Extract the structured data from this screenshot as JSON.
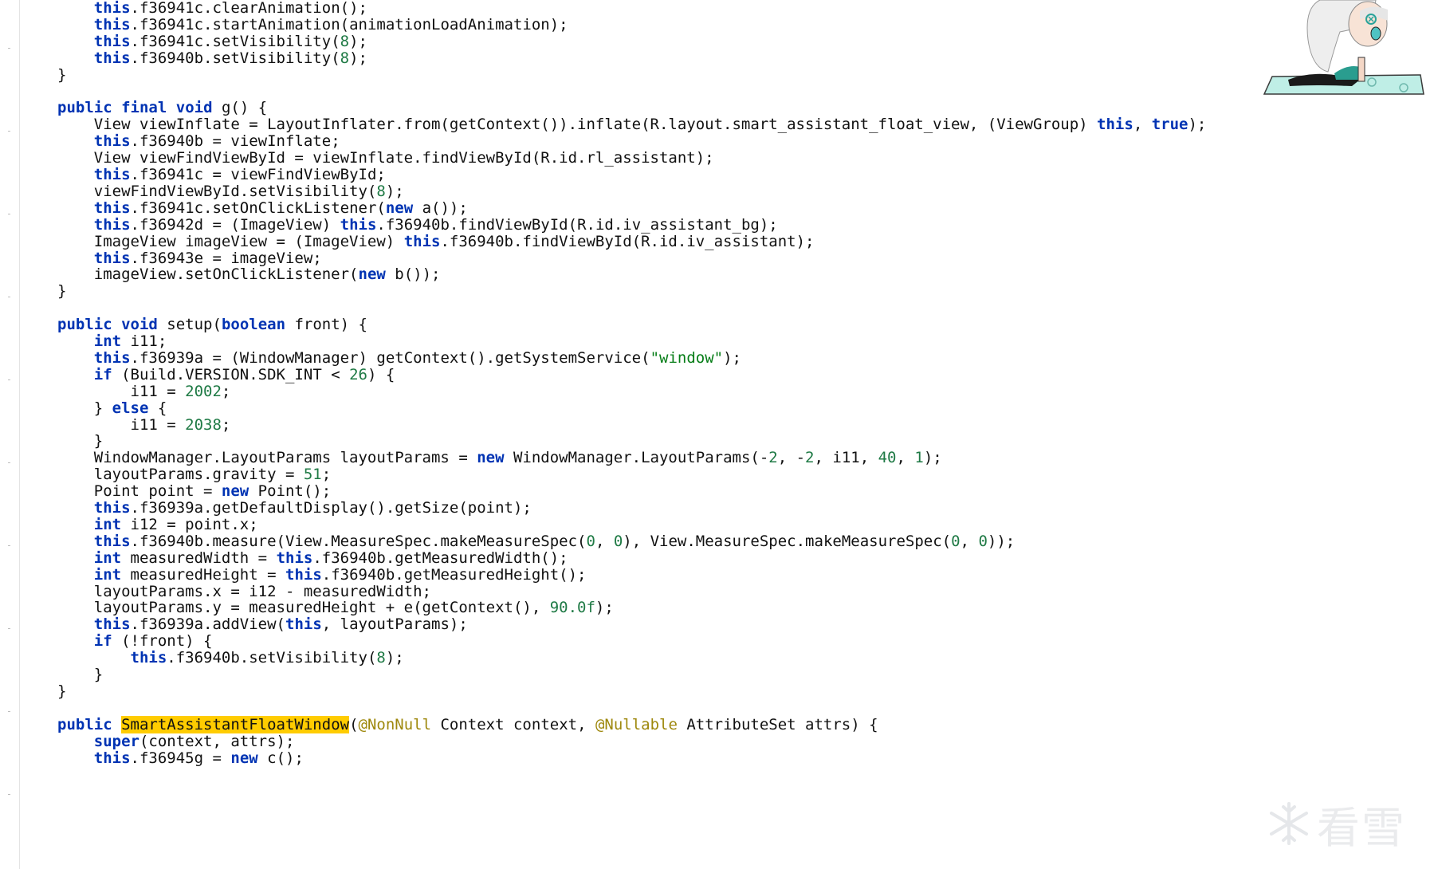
{
  "editor": {
    "lines": [
      [
        [
          "t",
          "    "
        ],
        [
          "kw",
          "this"
        ],
        [
          "t",
          ".f36941c.clearAnimation();"
        ]
      ],
      [
        [
          "t",
          "    "
        ],
        [
          "kw",
          "this"
        ],
        [
          "t",
          ".f36941c.startAnimation(animationLoadAnimation);"
        ]
      ],
      [
        [
          "t",
          "    "
        ],
        [
          "kw",
          "this"
        ],
        [
          "t",
          ".f36941c.setVisibility("
        ],
        [
          "num",
          "8"
        ],
        [
          "t",
          ");"
        ]
      ],
      [
        [
          "t",
          "    "
        ],
        [
          "kw",
          "this"
        ],
        [
          "t",
          ".f36940b.setVisibility("
        ],
        [
          "num",
          "8"
        ],
        [
          "t",
          ");"
        ]
      ],
      [
        [
          "t",
          "}"
        ]
      ],
      [
        [
          "t",
          ""
        ]
      ],
      [
        [
          "kw",
          "public"
        ],
        [
          "t",
          " "
        ],
        [
          "kw",
          "final"
        ],
        [
          "t",
          " "
        ],
        [
          "kw",
          "void"
        ],
        [
          "t",
          " g() {"
        ]
      ],
      [
        [
          "t",
          "    View viewInflate = LayoutInflater.from(getContext()).inflate(R.layout.smart_assistant_float_view, (ViewGroup) "
        ],
        [
          "kw",
          "this"
        ],
        [
          "t",
          ", "
        ],
        [
          "kw",
          "true"
        ],
        [
          "t",
          ");"
        ]
      ],
      [
        [
          "t",
          "    "
        ],
        [
          "kw",
          "this"
        ],
        [
          "t",
          ".f36940b = viewInflate;"
        ]
      ],
      [
        [
          "t",
          "    View viewFindViewById = viewInflate.findViewById(R.id.rl_assistant);"
        ]
      ],
      [
        [
          "t",
          "    "
        ],
        [
          "kw",
          "this"
        ],
        [
          "t",
          ".f36941c = viewFindViewById;"
        ]
      ],
      [
        [
          "t",
          "    viewFindViewById.setVisibility("
        ],
        [
          "num",
          "8"
        ],
        [
          "t",
          ");"
        ]
      ],
      [
        [
          "t",
          "    "
        ],
        [
          "kw",
          "this"
        ],
        [
          "t",
          ".f36941c.setOnClickListener("
        ],
        [
          "kw",
          "new"
        ],
        [
          "t",
          " a());"
        ]
      ],
      [
        [
          "t",
          "    "
        ],
        [
          "kw",
          "this"
        ],
        [
          "t",
          ".f36942d = (ImageView) "
        ],
        [
          "kw",
          "this"
        ],
        [
          "t",
          ".f36940b.findViewById(R.id.iv_assistant_bg);"
        ]
      ],
      [
        [
          "t",
          "    ImageView imageView = (ImageView) "
        ],
        [
          "kw",
          "this"
        ],
        [
          "t",
          ".f36940b.findViewById(R.id.iv_assistant);"
        ]
      ],
      [
        [
          "t",
          "    "
        ],
        [
          "kw",
          "this"
        ],
        [
          "t",
          ".f36943e = imageView;"
        ]
      ],
      [
        [
          "t",
          "    imageView.setOnClickListener("
        ],
        [
          "kw",
          "new"
        ],
        [
          "t",
          " b());"
        ]
      ],
      [
        [
          "t",
          "}"
        ]
      ],
      [
        [
          "t",
          ""
        ]
      ],
      [
        [
          "kw",
          "public"
        ],
        [
          "t",
          " "
        ],
        [
          "kw",
          "void"
        ],
        [
          "t",
          " setup("
        ],
        [
          "kw",
          "boolean"
        ],
        [
          "t",
          " front) {"
        ]
      ],
      [
        [
          "t",
          "    "
        ],
        [
          "kw",
          "int"
        ],
        [
          "t",
          " i11;"
        ]
      ],
      [
        [
          "t",
          "    "
        ],
        [
          "kw",
          "this"
        ],
        [
          "t",
          ".f36939a = (WindowManager) getContext().getSystemService("
        ],
        [
          "str",
          "\"window\""
        ],
        [
          "t",
          ");"
        ]
      ],
      [
        [
          "t",
          "    "
        ],
        [
          "kw",
          "if"
        ],
        [
          "t",
          " (Build.VERSION.SDK_INT < "
        ],
        [
          "num",
          "26"
        ],
        [
          "t",
          ") {"
        ]
      ],
      [
        [
          "t",
          "        i11 = "
        ],
        [
          "num",
          "2002"
        ],
        [
          "t",
          ";"
        ]
      ],
      [
        [
          "t",
          "    } "
        ],
        [
          "kw",
          "else"
        ],
        [
          "t",
          " {"
        ]
      ],
      [
        [
          "t",
          "        i11 = "
        ],
        [
          "num",
          "2038"
        ],
        [
          "t",
          ";"
        ]
      ],
      [
        [
          "t",
          "    }"
        ]
      ],
      [
        [
          "t",
          "    WindowManager.LayoutParams layoutParams = "
        ],
        [
          "kw",
          "new"
        ],
        [
          "t",
          " WindowManager.LayoutParams(-"
        ],
        [
          "num",
          "2"
        ],
        [
          "t",
          ", -"
        ],
        [
          "num",
          "2"
        ],
        [
          "t",
          ", i11, "
        ],
        [
          "num",
          "40"
        ],
        [
          "t",
          ", "
        ],
        [
          "num",
          "1"
        ],
        [
          "t",
          ");"
        ]
      ],
      [
        [
          "t",
          "    layoutParams.gravity = "
        ],
        [
          "num",
          "51"
        ],
        [
          "t",
          ";"
        ]
      ],
      [
        [
          "t",
          "    Point point = "
        ],
        [
          "kw",
          "new"
        ],
        [
          "t",
          " Point();"
        ]
      ],
      [
        [
          "t",
          "    "
        ],
        [
          "kw",
          "this"
        ],
        [
          "t",
          ".f36939a.getDefaultDisplay().getSize(point);"
        ]
      ],
      [
        [
          "t",
          "    "
        ],
        [
          "kw",
          "int"
        ],
        [
          "t",
          " i12 = point.x;"
        ]
      ],
      [
        [
          "t",
          "    "
        ],
        [
          "kw",
          "this"
        ],
        [
          "t",
          ".f36940b.measure(View.MeasureSpec.makeMeasureSpec("
        ],
        [
          "num",
          "0"
        ],
        [
          "t",
          ", "
        ],
        [
          "num",
          "0"
        ],
        [
          "t",
          "), View.MeasureSpec.makeMeasureSpec("
        ],
        [
          "num",
          "0"
        ],
        [
          "t",
          ", "
        ],
        [
          "num",
          "0"
        ],
        [
          "t",
          "));"
        ]
      ],
      [
        [
          "t",
          "    "
        ],
        [
          "kw",
          "int"
        ],
        [
          "t",
          " measuredWidth = "
        ],
        [
          "kw",
          "this"
        ],
        [
          "t",
          ".f36940b.getMeasuredWidth();"
        ]
      ],
      [
        [
          "t",
          "    "
        ],
        [
          "kw",
          "int"
        ],
        [
          "t",
          " measuredHeight = "
        ],
        [
          "kw",
          "this"
        ],
        [
          "t",
          ".f36940b.getMeasuredHeight();"
        ]
      ],
      [
        [
          "t",
          "    layoutParams.x = i12 - measuredWidth;"
        ]
      ],
      [
        [
          "t",
          "    layoutParams.y = measuredHeight + e(getContext(), "
        ],
        [
          "num",
          "90.0f"
        ],
        [
          "t",
          ");"
        ]
      ],
      [
        [
          "t",
          "    "
        ],
        [
          "kw",
          "this"
        ],
        [
          "t",
          ".f36939a.addView("
        ],
        [
          "kw",
          "this"
        ],
        [
          "t",
          ", layoutParams);"
        ]
      ],
      [
        [
          "t",
          "    "
        ],
        [
          "kw",
          "if"
        ],
        [
          "t",
          " (!front) {"
        ]
      ],
      [
        [
          "t",
          "        "
        ],
        [
          "kw",
          "this"
        ],
        [
          "t",
          ".f36940b.setVisibility("
        ],
        [
          "num",
          "8"
        ],
        [
          "t",
          ");"
        ]
      ],
      [
        [
          "t",
          "    }"
        ]
      ],
      [
        [
          "t",
          "}"
        ]
      ],
      [
        [
          "t",
          ""
        ]
      ],
      [
        [
          "kw",
          "public"
        ],
        [
          "t",
          " "
        ],
        [
          "hl",
          "SmartAssistantFloatWindow"
        ],
        [
          "t",
          "("
        ],
        [
          "ann",
          "@NonNull"
        ],
        [
          "t",
          " Context context, "
        ],
        [
          "ann",
          "@Nullable"
        ],
        [
          "t",
          " AttributeSet attrs) {"
        ]
      ],
      [
        [
          "t",
          "    "
        ],
        [
          "kw",
          "super"
        ],
        [
          "t",
          "(context, attrs);"
        ]
      ],
      [
        [
          "t",
          "    "
        ],
        [
          "kw",
          "this"
        ],
        [
          "t",
          ".f36945g = "
        ],
        [
          "kw",
          "new"
        ],
        [
          "t",
          " c();"
        ]
      ]
    ]
  },
  "watermark": {
    "text": "看雪",
    "icon": "snowflake-icon"
  },
  "mascot": {
    "icon": "chibi-character-yoga-mat-icon"
  },
  "colors": {
    "keyword": "#0033b3",
    "number": "#1f7a45",
    "string": "#067d17",
    "annotation": "#9e880d",
    "highlight": "#ffcc00",
    "text": "#111111"
  }
}
